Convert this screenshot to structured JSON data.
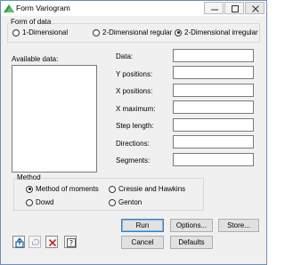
{
  "window": {
    "title": "Form Variogram",
    "icon": "variogram-app-icon"
  },
  "form_of_data": {
    "legend": "Form of data",
    "options": [
      {
        "label": "1-Dimensional",
        "selected": false
      },
      {
        "label": "2-Dimensional regular",
        "selected": false
      },
      {
        "label": "2-Dimensional irregular",
        "selected": true
      }
    ]
  },
  "available_data": {
    "label": "Available data:"
  },
  "fields": [
    {
      "label": "Data:",
      "value": ""
    },
    {
      "label": "Y positions:",
      "value": ""
    },
    {
      "label": "X positions:",
      "value": ""
    },
    {
      "label": "X maximum:",
      "value": ""
    },
    {
      "label": "Step length:",
      "value": ""
    },
    {
      "label": "Directions:",
      "value": ""
    },
    {
      "label": "Segments:",
      "value": ""
    }
  ],
  "method": {
    "legend": "Method",
    "options": [
      {
        "label": "Method of moments",
        "selected": true
      },
      {
        "label": "Cressie and Hawkins",
        "selected": false
      },
      {
        "label": "Dowd",
        "selected": false
      },
      {
        "label": "Genton",
        "selected": false
      }
    ]
  },
  "buttons": {
    "run": "Run",
    "options": "Options...",
    "store": "Store...",
    "cancel": "Cancel",
    "defaults": "Defaults"
  },
  "toolbar_icons": [
    "send-to-output-icon",
    "clear-icon",
    "close-icon",
    "help-icon"
  ],
  "colors": {
    "accent": "#0078d7",
    "title_icon_green": "#2e9e4a",
    "close_red": "#c0281f"
  }
}
